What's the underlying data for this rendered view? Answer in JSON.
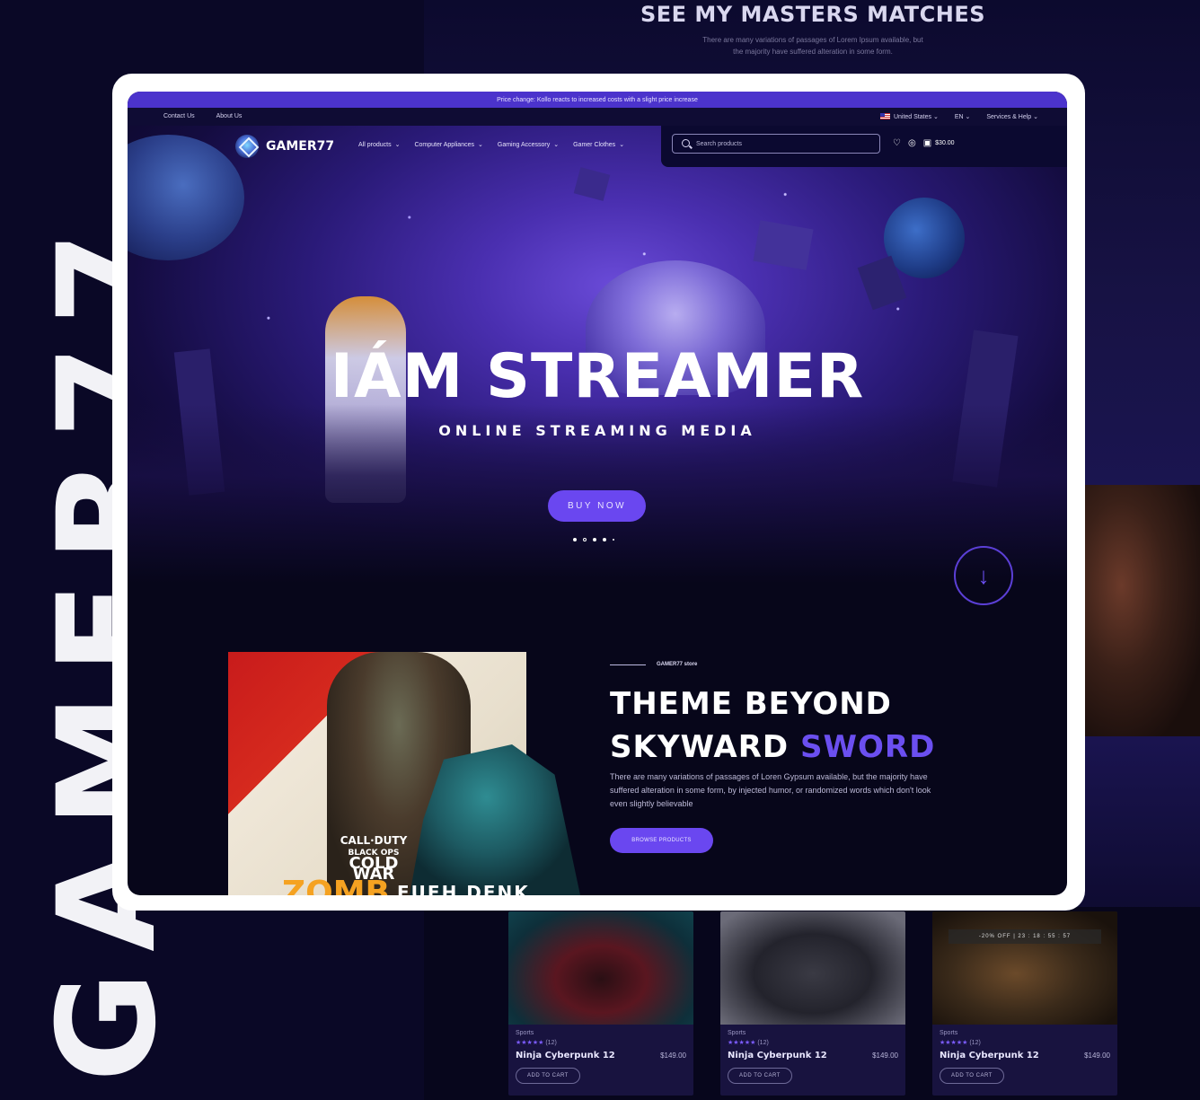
{
  "brand_vertical": "GAMER77",
  "background_section": {
    "title": "SEE MY MASTERS MATCHES",
    "line1": "There are many variations of passages of Lorem Ipsum available, but",
    "line2": "the majority have suffered alteration in some form."
  },
  "announcement": "Price change: Kollo reacts to increased costs with a slight price increase",
  "topbar": {
    "contact": "Contact Us",
    "about": "About Us",
    "country": "United States",
    "language": "EN",
    "services": "Services & Help"
  },
  "nav": {
    "logo": "GAMER77",
    "menu": [
      "All products",
      "Computer Appliances",
      "Gaming Accessory",
      "Gamer Clothes"
    ],
    "search_placeholder": "Search products",
    "cart_total": "$30.00"
  },
  "hero": {
    "title": "IÁM STREAMER",
    "subtitle": "ONLINE STREAMING MEDIA",
    "button": "BUY NOW",
    "slides": 5,
    "active_slide": 3
  },
  "promo": {
    "tag": "GAMER77 store",
    "heading_line1": "THEME BEYOND",
    "heading_line2a": "SKYWARD",
    "heading_line2b": "SWORD",
    "paragraph": "There are many variations of passages of Loren Gypsum available, but the majority have suffered alteration in some form, by injected humor, or randomized words which don't look even slightly believable",
    "button": "BROWSE PRODUCTS",
    "image_line1": "CALL·DUTY",
    "image_line2": "BLACK OPS",
    "image_line3": "COLD WAR",
    "image_line4": "ZOMB",
    "mascot_text": "FUEH DENK"
  },
  "products": [
    {
      "category": "Sports",
      "stars": "★★★★★",
      "reviews": "(12)",
      "name": "Ninja Cyberpunk 12",
      "price": "$149.00",
      "cart": "ADD TO CART",
      "timer": ""
    },
    {
      "category": "Sports",
      "stars": "★★★★★",
      "reviews": "(12)",
      "name": "Ninja Cyberpunk 12",
      "price": "$149.00",
      "cart": "ADD TO CART",
      "timer": ""
    },
    {
      "category": "Sports",
      "stars": "★★★★★",
      "reviews": "(12)",
      "name": "Ninja Cyberpunk 12",
      "price": "$149.00",
      "cart": "ADD TO CART",
      "timer": "-20% OFF  |  23 : 18 : 55 : 57"
    }
  ],
  "colors": {
    "accent": "#6a47f0",
    "background": "#0a0826",
    "frame": "#ffffff"
  }
}
